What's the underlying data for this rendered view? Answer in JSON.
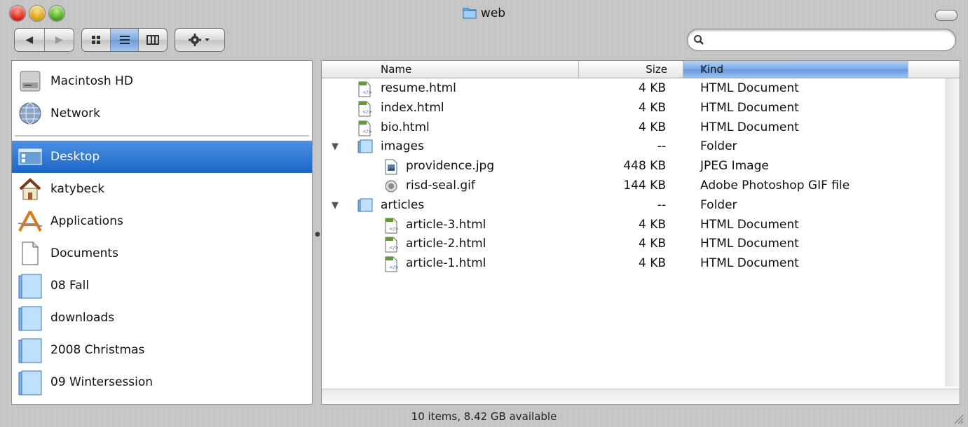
{
  "window": {
    "title": "web"
  },
  "toolbar": {
    "back_glyph": "◀",
    "forward_glyph": "▶",
    "views": [
      "icon-view",
      "list-view",
      "column-view"
    ],
    "active_view": "list-view",
    "action_icon": "gear-icon",
    "search": {
      "value": "",
      "placeholder": ""
    }
  },
  "sidebar": {
    "devices": [
      {
        "label": "Macintosh HD",
        "icon": "hard-drive-icon"
      },
      {
        "label": "Network",
        "icon": "network-globe-icon"
      }
    ],
    "places": [
      {
        "label": "Desktop",
        "icon": "desktop-icon",
        "selected": true
      },
      {
        "label": "katybeck",
        "icon": "home-icon"
      },
      {
        "label": "Applications",
        "icon": "applications-icon"
      },
      {
        "label": "Documents",
        "icon": "documents-icon"
      },
      {
        "label": "08 Fall",
        "icon": "folder-icon"
      },
      {
        "label": "downloads",
        "icon": "folder-icon"
      },
      {
        "label": "2008 Christmas",
        "icon": "folder-icon"
      },
      {
        "label": "09 Wintersession",
        "icon": "folder-icon"
      }
    ]
  },
  "list": {
    "columns": {
      "name": "Name",
      "size": "Size",
      "kind": "Kind"
    },
    "sort_column": "Kind",
    "rows": [
      {
        "name": "resume.html",
        "size": "4 KB",
        "kind": "HTML Document",
        "indent": 0,
        "icon": "html-file-icon"
      },
      {
        "name": "index.html",
        "size": "4 KB",
        "kind": "HTML Document",
        "indent": 0,
        "icon": "html-file-icon"
      },
      {
        "name": "bio.html",
        "size": "4 KB",
        "kind": "HTML Document",
        "indent": 0,
        "icon": "html-file-icon"
      },
      {
        "name": "images",
        "size": "--",
        "kind": "Folder",
        "indent": 0,
        "icon": "folder-icon",
        "expanded": true
      },
      {
        "name": "providence.jpg",
        "size": "448 KB",
        "kind": "JPEG Image",
        "indent": 1,
        "icon": "jpeg-file-icon"
      },
      {
        "name": "risd-seal.gif",
        "size": "144 KB",
        "kind": "Adobe Photoshop GIF file",
        "indent": 1,
        "icon": "gif-file-icon"
      },
      {
        "name": "articles",
        "size": "--",
        "kind": "Folder",
        "indent": 0,
        "icon": "folder-icon",
        "expanded": true
      },
      {
        "name": "article-3.html",
        "size": "4 KB",
        "kind": "HTML Document",
        "indent": 1,
        "icon": "html-file-icon"
      },
      {
        "name": "article-2.html",
        "size": "4 KB",
        "kind": "HTML Document",
        "indent": 1,
        "icon": "html-file-icon"
      },
      {
        "name": "article-1.html",
        "size": "4 KB",
        "kind": "HTML Document",
        "indent": 1,
        "icon": "html-file-icon"
      }
    ]
  },
  "status": {
    "text": "10 items, 8.42 GB available"
  },
  "colors": {
    "selection": "#1c66c8",
    "sort_header": "#7aaae6"
  }
}
